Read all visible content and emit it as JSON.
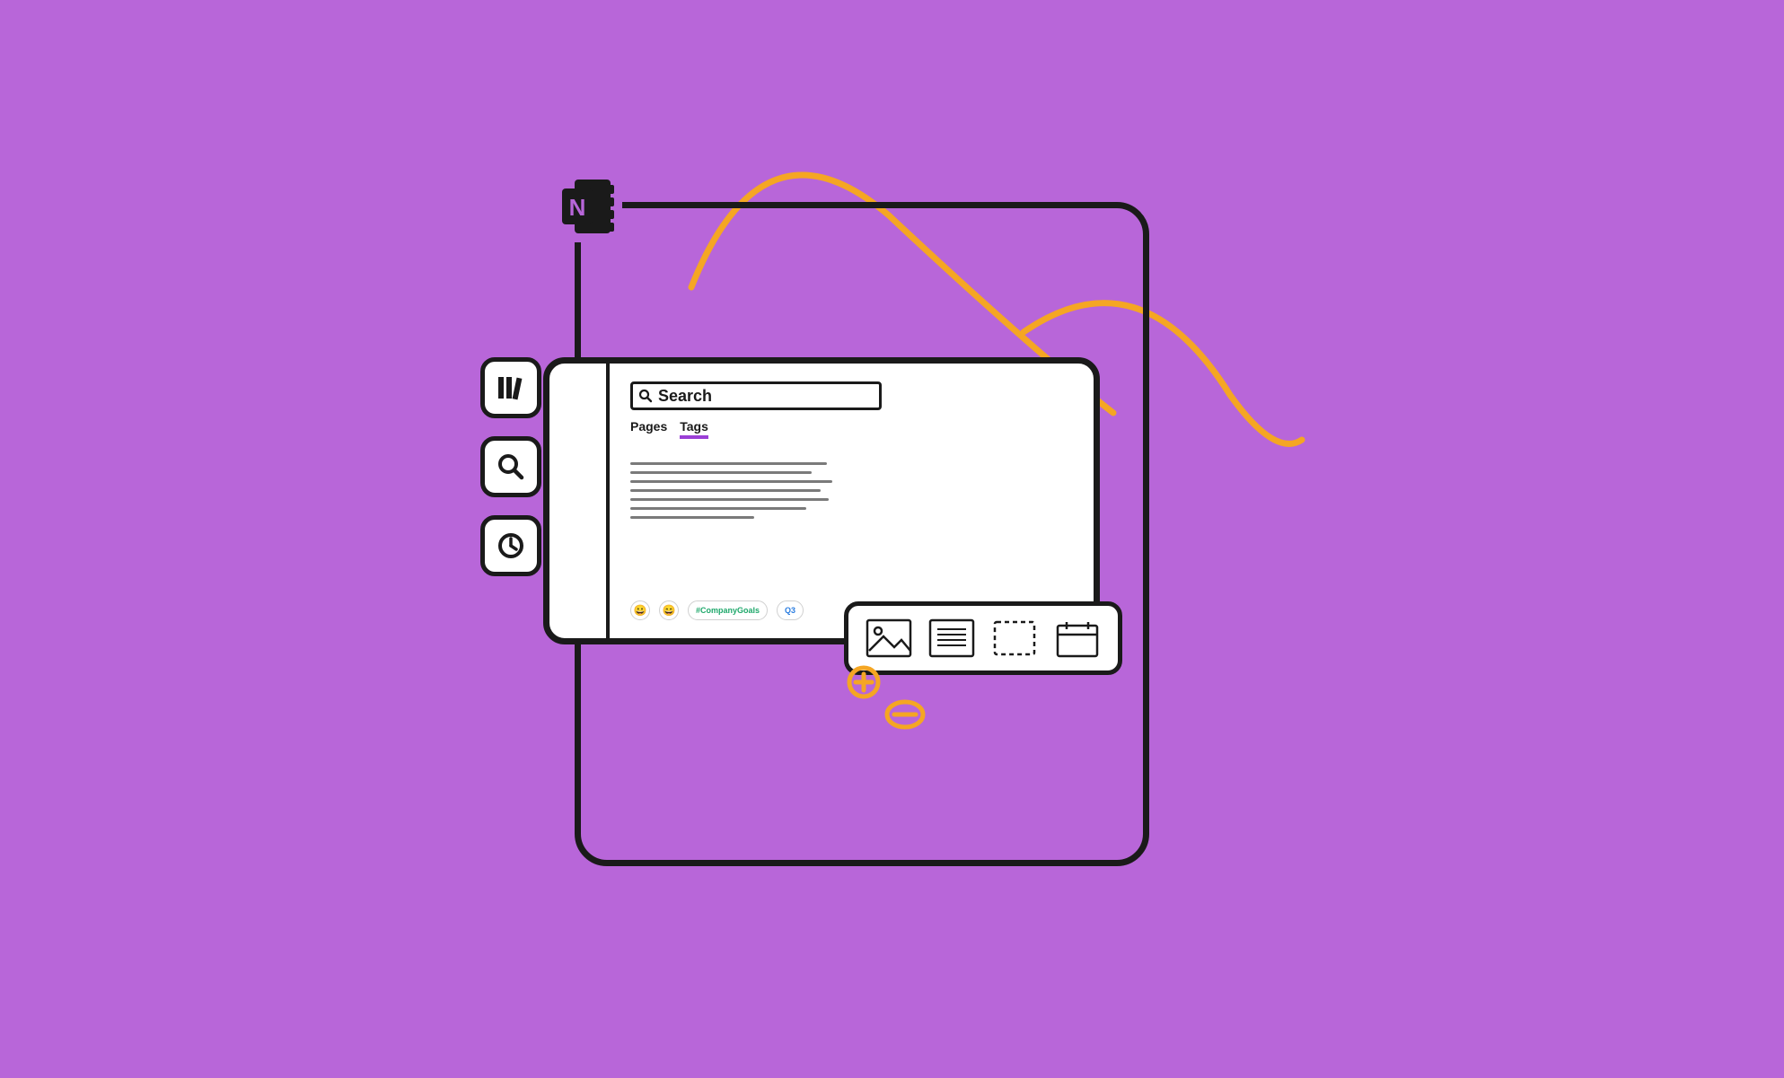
{
  "app_logo": {
    "letter": "N"
  },
  "side": {
    "library_icon": "library-icon",
    "search_icon": "search-icon",
    "recent_icon": "clock-icon"
  },
  "window": {
    "search_placeholder": "Search",
    "tabs": {
      "pages": "Pages",
      "tags": "Tags"
    },
    "active_tab": "tags"
  },
  "chips": {
    "emoji1": "😀",
    "emoji2": "😄",
    "tag1": "#CompanyGoals",
    "tag2": "Q3"
  },
  "toolbar": {
    "image": "image-icon",
    "text": "text-block-icon",
    "placeholder": "placeholder-icon",
    "calendar": "calendar-icon"
  },
  "decor": {
    "plus_icon": "plus-icon",
    "minus_icon": "minus-icon"
  }
}
